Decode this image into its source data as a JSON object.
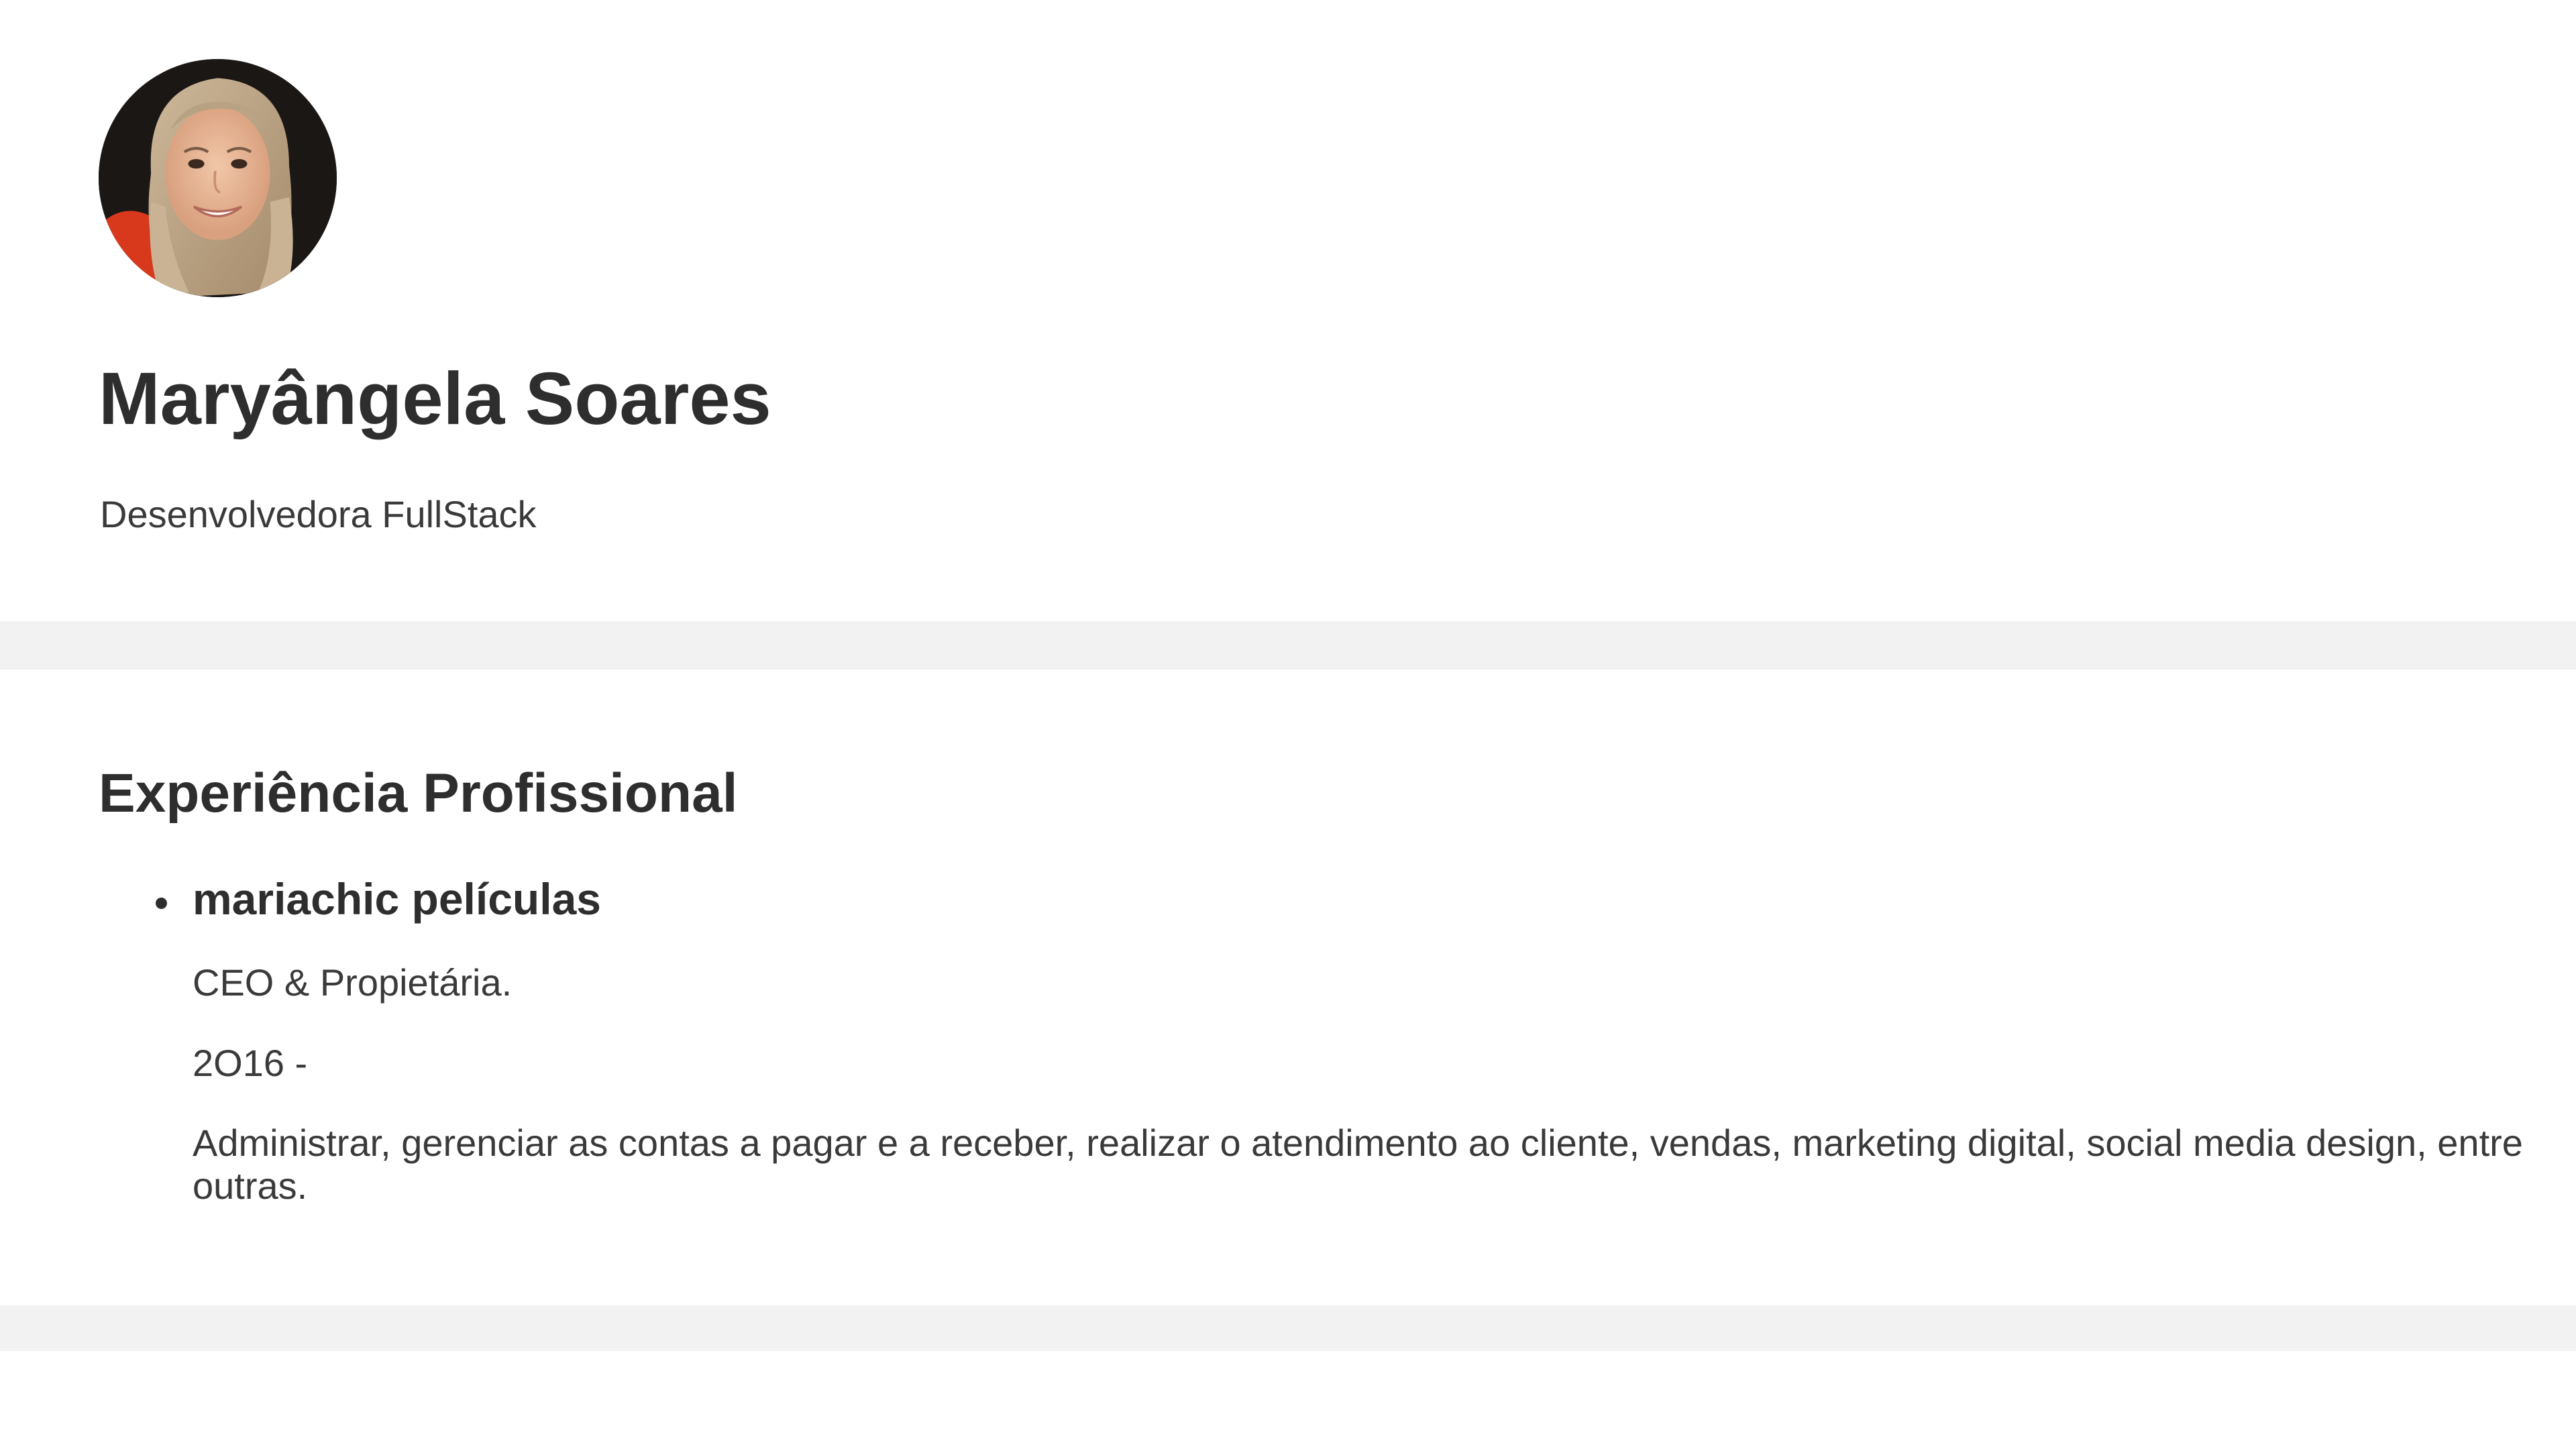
{
  "profile": {
    "name": "Maryângela Soares",
    "role": "Desenvolvedora FullStack",
    "avatar_icon": "profile-photo"
  },
  "experience": {
    "title": "Experiência Profissional",
    "jobs": [
      {
        "company": "mariachic películas",
        "position": "CEO & Propietária.",
        "period": "2O16 -",
        "description": "Administrar, gerenciar as contas a pagar e a receber, realizar o atendimento ao cliente, vendas, marketing digital, social media design, entre outras."
      }
    ]
  },
  "colors": {
    "background": "#ffffff",
    "separator": "#f2f2f2",
    "text": "#333333"
  }
}
